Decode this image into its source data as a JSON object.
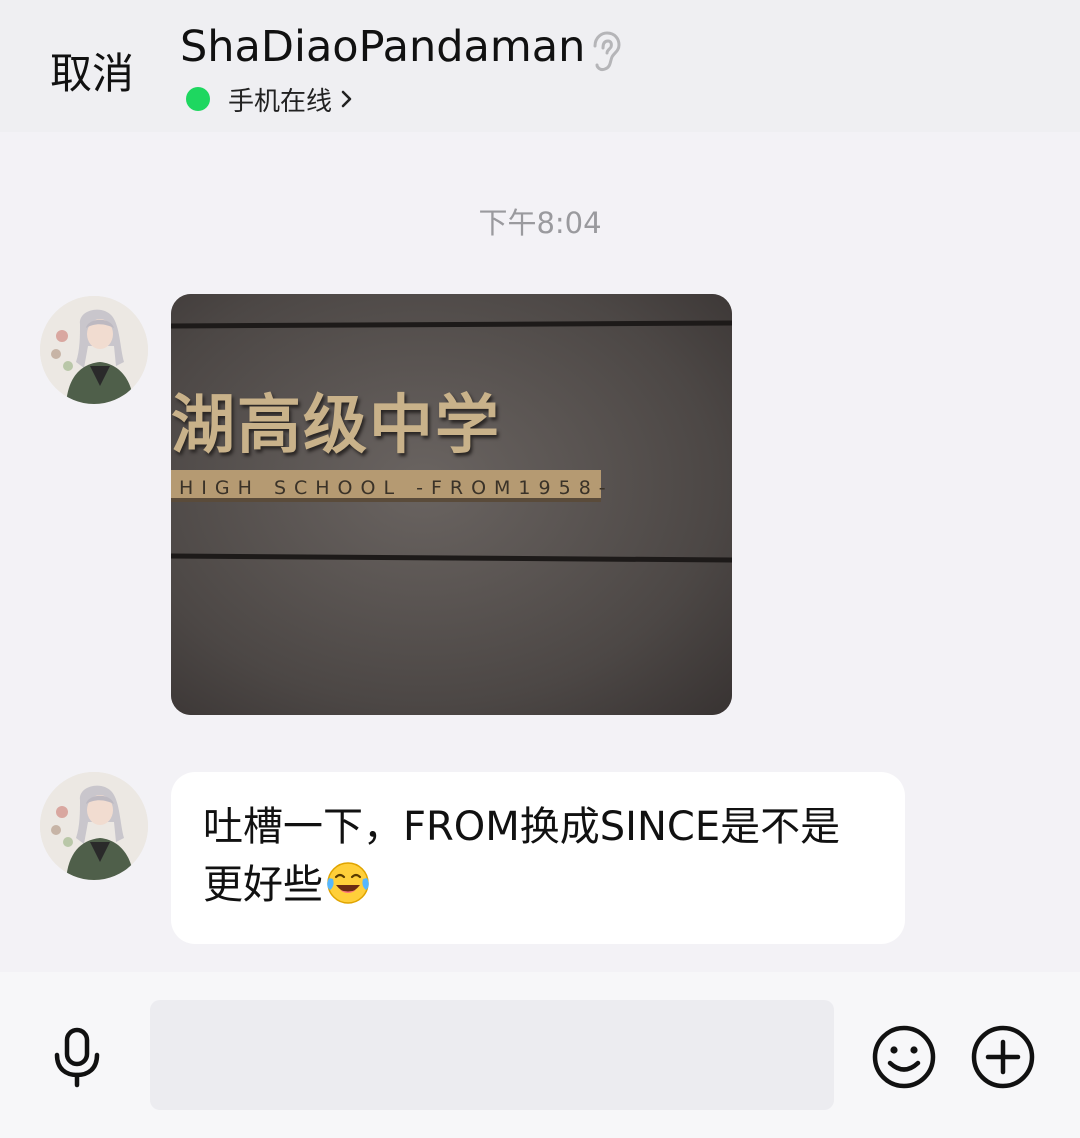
{
  "header": {
    "cancel_label": "取消",
    "contact_name": "ShaDiaoPandaman",
    "status_text": "手机在线",
    "status_color": "#1ed760",
    "icons": [
      "ear-icon",
      "chevron-right-icon"
    ]
  },
  "chat": {
    "timestamp": "下午8:04",
    "messages": [
      {
        "type": "image",
        "sender": "contact",
        "image_text_cn": "湖高级中学",
        "image_text_en": "HIGH SCHOOL -FROM1958-"
      },
      {
        "type": "text",
        "sender": "contact",
        "text": "吐槽一下，FROM换成SINCE是不是更好些",
        "emoji": "face-with-tears-of-joy"
      }
    ]
  },
  "bottom_bar": {
    "input_value": "",
    "icons": [
      "microphone-icon",
      "smiley-icon",
      "plus-icon"
    ]
  }
}
